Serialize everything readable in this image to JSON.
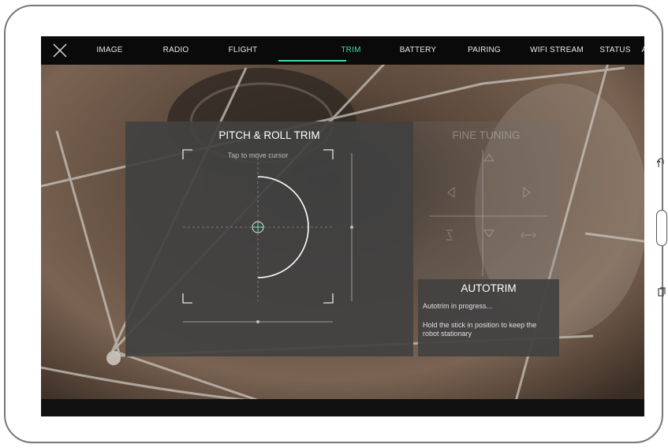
{
  "nav": {
    "tabs": [
      {
        "label": "IMAGE"
      },
      {
        "label": "RADIO"
      },
      {
        "label": "FLIGHT"
      },
      {
        "label": "TRIM"
      },
      {
        "label": "BATTERY"
      },
      {
        "label": "PAIRING"
      },
      {
        "label": "WIFI STREAM"
      },
      {
        "label": "STATUS"
      },
      {
        "label": "A"
      }
    ],
    "active_tab": "TRIM"
  },
  "trim_panel": {
    "title": "PITCH & ROLL TRIM",
    "hint": "Tap to move cursor"
  },
  "fine_panel": {
    "title": "FINE TUNING"
  },
  "autotrim_panel": {
    "title": "AUTOTRIM",
    "status": "Autotrim in progress...",
    "instruction": "Hold the stick in position to keep the robot stationary"
  },
  "colors": {
    "accent": "#49d7a2",
    "panel": "#424242",
    "topbar": "#0a0a0a"
  },
  "icons": {
    "close": "close-icon",
    "back": "back-icon",
    "recents": "recents-icon"
  }
}
